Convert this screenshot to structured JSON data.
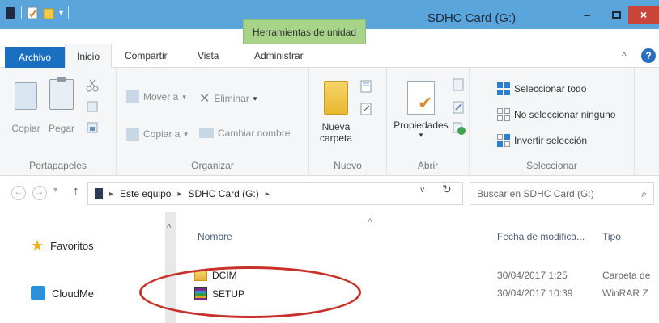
{
  "window": {
    "title": "SDHC Card (G:)",
    "contextual_tab": "Herramientas de unidad",
    "controls": {
      "minimize": "–",
      "maximize": "□",
      "close": "×"
    }
  },
  "tabs": {
    "file": "Archivo",
    "inicio": "Inicio",
    "compartir": "Compartir",
    "vista": "Vista",
    "administrar": "Administrar",
    "help_caret": "^",
    "help": "?"
  },
  "ribbon": {
    "portapapeles": {
      "label": "Portapapeles",
      "copiar": "Copiar",
      "pegar": "Pegar"
    },
    "organizar": {
      "label": "Organizar",
      "mover": "Mover a",
      "copiar_a": "Copiar a",
      "eliminar": "Eliminar",
      "cambiar": "Cambiar nombre"
    },
    "nuevo": {
      "label": "Nuevo",
      "nueva_carpeta_1": "Nueva",
      "nueva_carpeta_2": "carpeta"
    },
    "abrir": {
      "label": "Abrir",
      "propiedades": "Propiedades"
    },
    "seleccionar": {
      "label": "Seleccionar",
      "todo": "Seleccionar todo",
      "ninguno": "No seleccionar ninguno",
      "invertir": "Invertir selección"
    }
  },
  "address": {
    "crumbs": [
      "Este equipo",
      "SDHC Card (G:)"
    ],
    "search_placeholder": "Buscar en SDHC Card (G:)"
  },
  "navpane": {
    "items": [
      {
        "label": "Favoritos",
        "icon": "star-icon"
      },
      {
        "label": "CloudMe",
        "icon": "cloudme-icon"
      }
    ]
  },
  "filelist": {
    "columns": {
      "name": "Nombre",
      "date": "Fecha de modifica...",
      "type": "Tipo"
    },
    "rows": [
      {
        "name": "DCIM",
        "date": "30/04/2017 1:25",
        "type": "Carpeta de",
        "icon": "folder-icon"
      },
      {
        "name": "SETUP",
        "date": "30/04/2017 10:39",
        "type": "WinRAR Z",
        "icon": "winrar-icon"
      }
    ]
  },
  "colors": {
    "titlebar": "#5aa6dc",
    "file_tab": "#1a6fc1",
    "context_tab": "#a8d48a",
    "close": "#c9453a",
    "annotation": "#c8302a"
  }
}
